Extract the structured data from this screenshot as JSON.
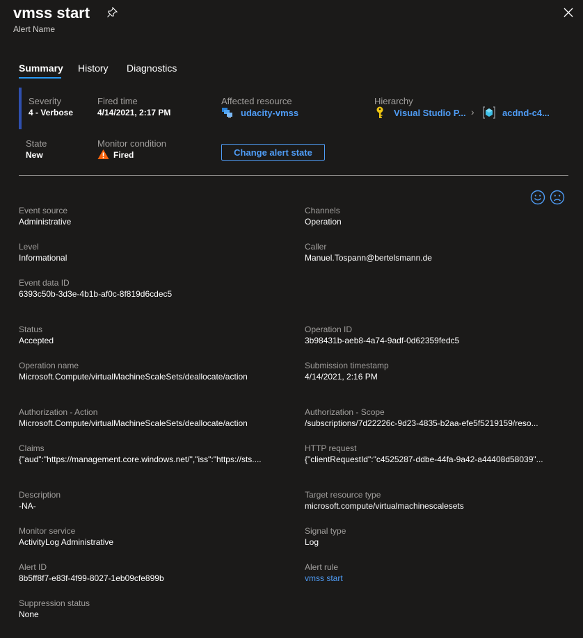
{
  "header": {
    "title": "vmss start",
    "subtitle": "Alert Name"
  },
  "tabs": [
    "Summary",
    "History",
    "Diagnostics"
  ],
  "summary": {
    "severity_label": "Severity",
    "severity_value": "4 - Verbose",
    "fired_time_label": "Fired time",
    "fired_time_value": "4/14/2021, 2:17 PM",
    "affected_resource_label": "Affected resource",
    "affected_resource_value": "udacity-vmss",
    "hierarchy_label": "Hierarchy",
    "hierarchy_item1": "Visual Studio P...",
    "hierarchy_separator": "›",
    "hierarchy_item2": "acdnd-c4...",
    "state_label": "State",
    "state_value": "New",
    "monitor_condition_label": "Monitor condition",
    "monitor_condition_value": "Fired",
    "change_state_button": "Change alert state"
  },
  "details": {
    "event_source": {
      "label": "Event source",
      "value": "Administrative"
    },
    "channels": {
      "label": "Channels",
      "value": "Operation"
    },
    "level": {
      "label": "Level",
      "value": "Informational"
    },
    "caller": {
      "label": "Caller",
      "value": "Manuel.Tospann@bertelsmann.de"
    },
    "event_data_id": {
      "label": "Event data ID",
      "value": "6393c50b-3d3e-4b1b-af0c-8f819d6cdec5"
    },
    "status": {
      "label": "Status",
      "value": "Accepted"
    },
    "operation_id": {
      "label": "Operation ID",
      "value": "3b98431b-aeb8-4a74-9adf-0d62359fedc5"
    },
    "operation_name": {
      "label": "Operation name",
      "value": "Microsoft.Compute/virtualMachineScaleSets/deallocate/action"
    },
    "submission_timestamp": {
      "label": "Submission timestamp",
      "value": "4/14/2021, 2:16 PM"
    },
    "authorization_action": {
      "label": "Authorization - Action",
      "value": "Microsoft.Compute/virtualMachineScaleSets/deallocate/action"
    },
    "authorization_scope": {
      "label": "Authorization - Scope",
      "value": "/subscriptions/7d22226c-9d23-4835-b2aa-efe5f5219159/reso..."
    },
    "claims": {
      "label": "Claims",
      "value": "{\"aud\":\"https://management.core.windows.net/\",\"iss\":\"https://sts...."
    },
    "http_request": {
      "label": "HTTP request",
      "value": "{\"clientRequestId\":\"c4525287-ddbe-44fa-9a42-a44408d58039\"..."
    },
    "description": {
      "label": "Description",
      "value": "-NA-"
    },
    "target_resource_type": {
      "label": "Target resource type",
      "value": "microsoft.compute/virtualmachinescalesets"
    },
    "monitor_service": {
      "label": "Monitor service",
      "value": "ActivityLog Administrative"
    },
    "signal_type": {
      "label": "Signal type",
      "value": "Log"
    },
    "alert_id": {
      "label": "Alert ID",
      "value": "8b5ff8f7-e83f-4f99-8027-1eb09cfe899b"
    },
    "alert_rule": {
      "label": "Alert rule",
      "value": "vmss start"
    },
    "suppression_status": {
      "label": "Suppression status",
      "value": "None"
    }
  },
  "colors": {
    "background": "#1b1a19",
    "accent": "#4f9cf5",
    "severity_bar": "#2f4fae",
    "warning": "#f7630c"
  }
}
